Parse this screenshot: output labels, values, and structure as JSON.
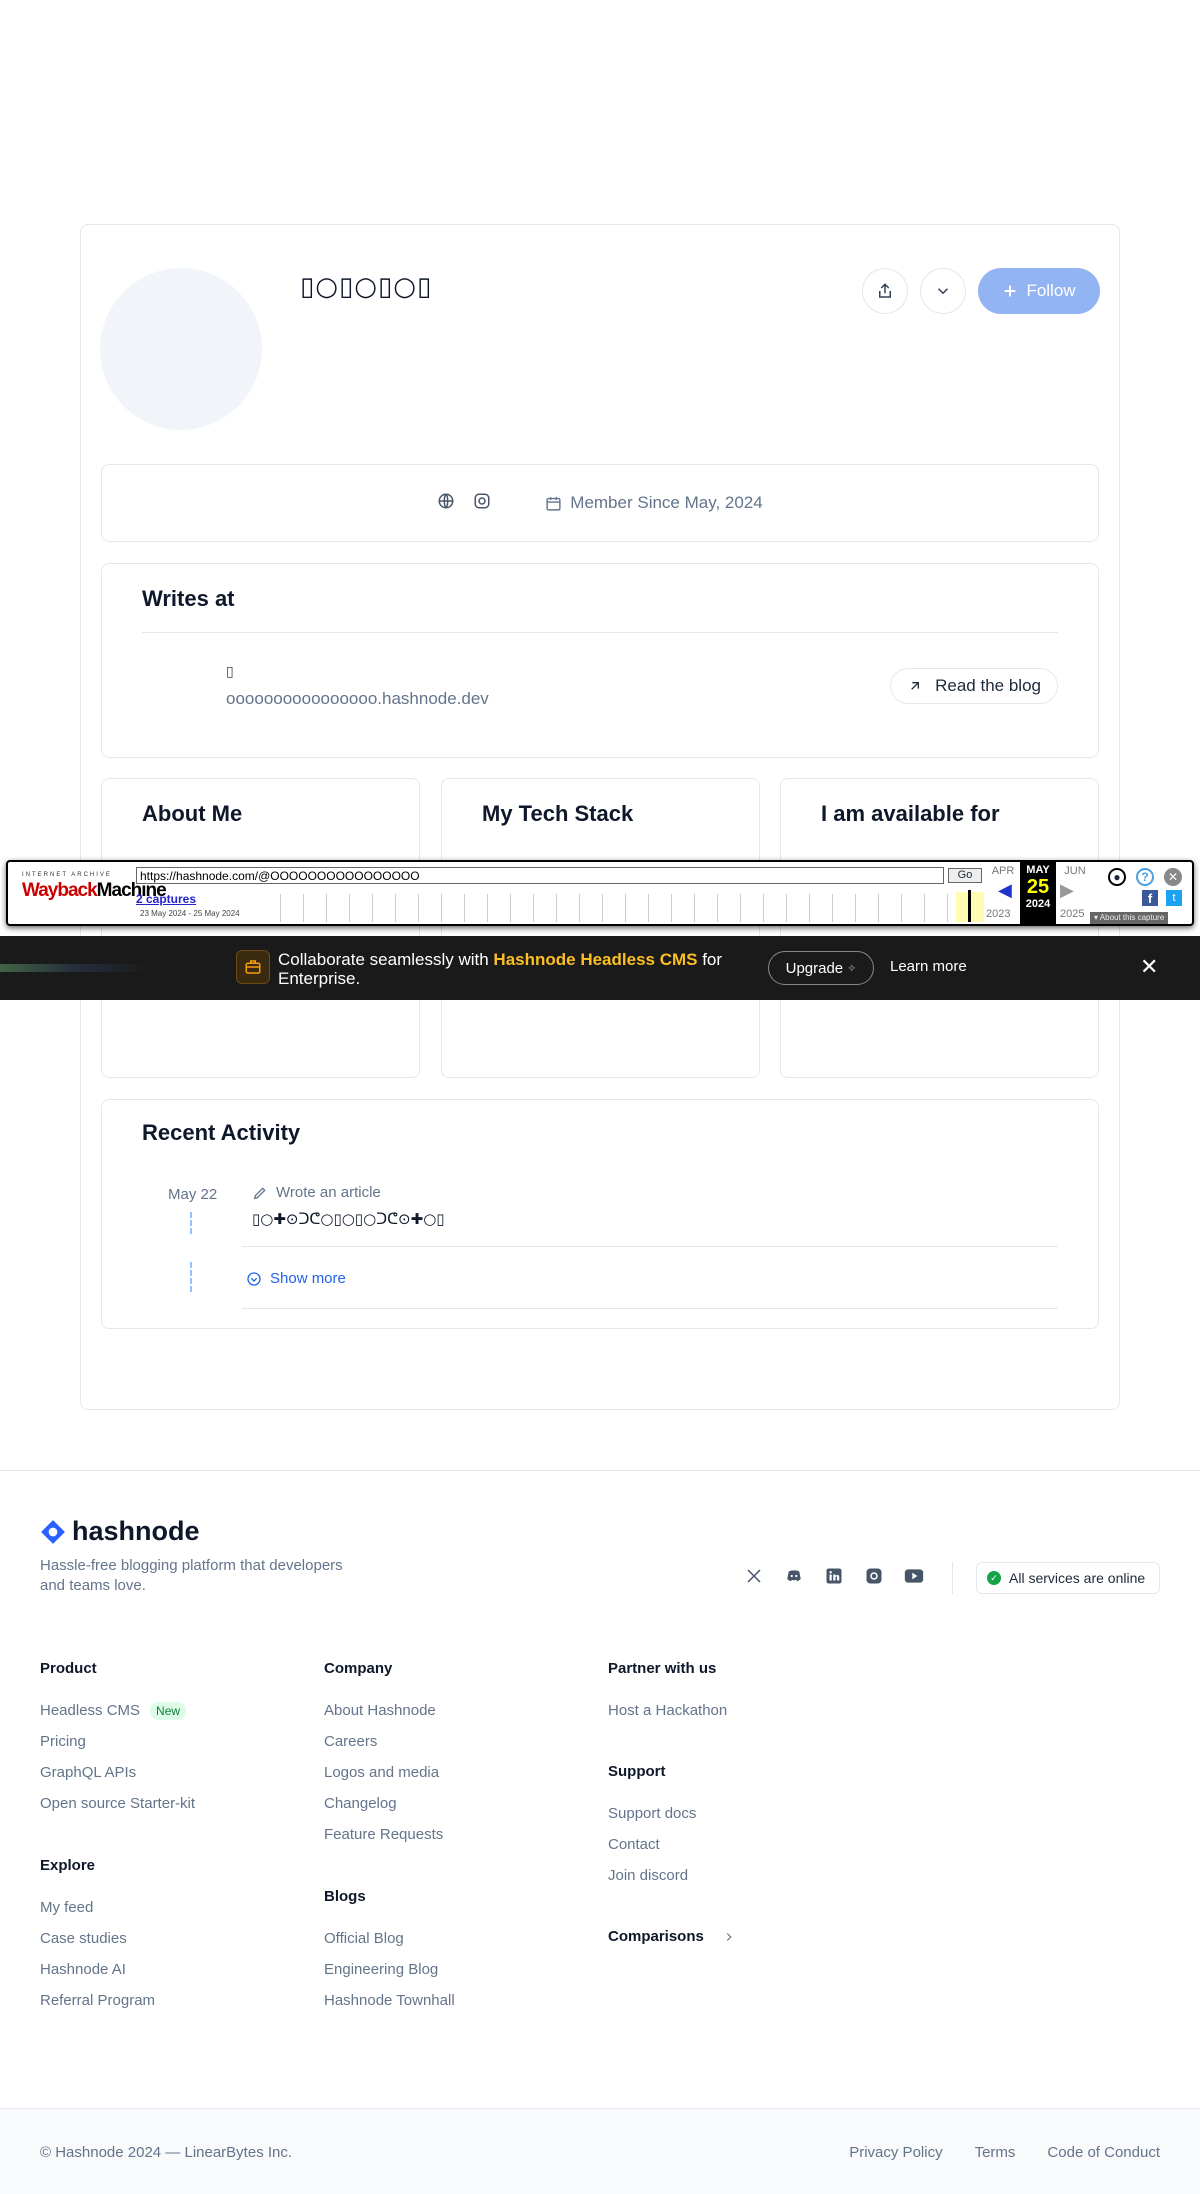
{
  "profile": {
    "name": "▯○▯○▯○▯",
    "follow_label": "Follow",
    "member_since": "Member Since May, 2024"
  },
  "writes_at": {
    "title": "Writes at",
    "blog_name": "▯",
    "blog_domain": "oooooooooooooooo.hashnode.dev",
    "read_label": "Read the blog"
  },
  "columns": {
    "about_title": "About Me",
    "stack_title": "My Tech Stack",
    "available_title": "I am available for"
  },
  "activity": {
    "title": "Recent Activity",
    "items": [
      {
        "date": "May 22",
        "type": "Wrote an article",
        "title": "▯○✚⊙ᑐᕦ○▯○▯○ᑐᕦ⊙✚○▯"
      }
    ],
    "show_more": "Show more"
  },
  "wayback": {
    "logo_top": "INTERNET ARCHIVE",
    "logo_red": "Wayback",
    "logo_black": "Machine",
    "url": "https://hashnode.com/@OOOOOOOOOOOOOOOO",
    "go": "Go",
    "captures": "2 captures",
    "range": "23 May 2024 - 25 May 2024",
    "prev_month": "APR",
    "cur_month": "MAY",
    "cur_day": "25",
    "cur_year": "2024",
    "next_month": "JUN",
    "prev_year": "2023",
    "next_year": "2025",
    "about": "▾ About this capture"
  },
  "promo": {
    "text_before": "Collaborate seamlessly with ",
    "highlight": "Hashnode Headless CMS",
    "text_after": " for Enterprise.",
    "upgrade": "Upgrade",
    "learn_more": "Learn more"
  },
  "footer": {
    "brand": "hashnode",
    "tagline": "Hassle-free blogging platform that developers and teams love.",
    "status": "All services are online",
    "product": {
      "title": "Product",
      "items": [
        "Headless CMS",
        "Pricing",
        "GraphQL APIs",
        "Open source Starter-kit"
      ],
      "new_badge": "New"
    },
    "explore": {
      "title": "Explore",
      "items": [
        "My feed",
        "Case studies",
        "Hashnode AI",
        "Referral Program"
      ]
    },
    "company": {
      "title": "Company",
      "items": [
        "About Hashnode",
        "Careers",
        "Logos and media",
        "Changelog",
        "Feature Requests"
      ]
    },
    "blogs": {
      "title": "Blogs",
      "items": [
        "Official Blog",
        "Engineering Blog",
        "Hashnode Townhall"
      ]
    },
    "partner": {
      "title": "Partner with us",
      "items": [
        "Host a Hackathon"
      ]
    },
    "support": {
      "title": "Support",
      "items": [
        "Support docs",
        "Contact",
        "Join discord"
      ]
    },
    "comparisons": "Comparisons",
    "copyright": "© Hashnode 2024 — LinearBytes Inc.",
    "legal": [
      "Privacy Policy",
      "Terms",
      "Code of Conduct"
    ]
  }
}
